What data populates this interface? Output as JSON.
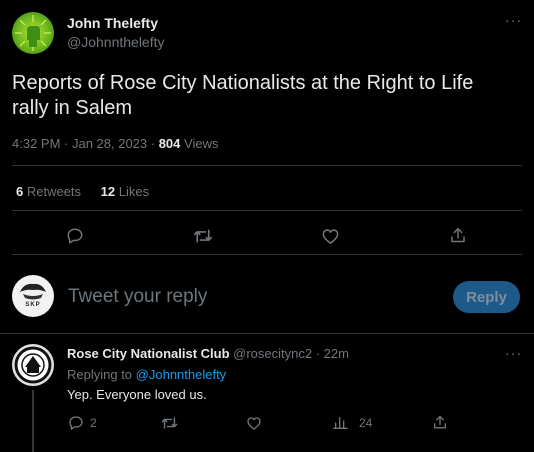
{
  "tweet": {
    "author_name": "John Thelefty",
    "author_handle": "@Johnnthelefty",
    "text": "Reports of Rose City Nationalists at the Right to Life rally in Salem",
    "time": "4:32 PM · Jan 28, 2023 · ",
    "views_count": "804",
    "views_label": " Views",
    "retweets_count": "6",
    "retweets_label": " Retweets",
    "likes_count": "12",
    "likes_label": " Likes"
  },
  "compose": {
    "placeholder": "Tweet your reply",
    "reply_label": "Reply",
    "avatar_text": "SKP"
  },
  "reply": {
    "author_name": "Rose City Nationalist Club",
    "author_handle": "@rosecitync2 · 22m",
    "replying_prefix": "Replying to ",
    "replying_to": "@Johnnthelefty",
    "text": "Yep. Everyone loved us.",
    "reply_count": "2",
    "views_count": "24"
  },
  "colors": {
    "background": "#000000",
    "text": "#e7e9ea",
    "muted": "#71767b",
    "link": "#1d9bf0",
    "reply_button": "#1d5a8a"
  },
  "icons": [
    "more-icon",
    "reply-icon",
    "retweet-icon",
    "like-icon",
    "share-icon",
    "views-icon"
  ]
}
